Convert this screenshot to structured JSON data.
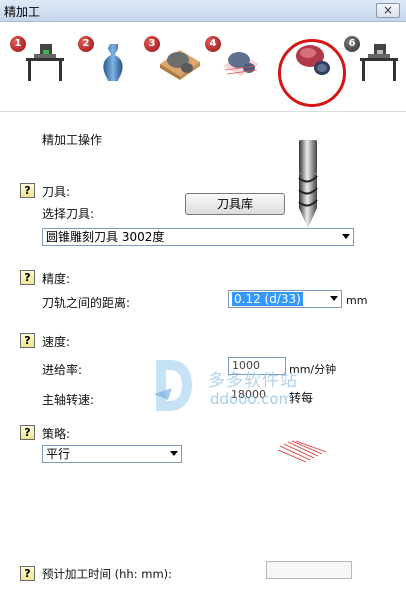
{
  "window": {
    "title": "精加工",
    "close_label": "×"
  },
  "steps": [
    {
      "number": "1",
      "icon": "machine-setup-icon"
    },
    {
      "number": "2",
      "icon": "model-vase-icon"
    },
    {
      "number": "3",
      "icon": "roughing-icon"
    },
    {
      "number": "4",
      "icon": "semi-finishing-icon"
    },
    {
      "number": "5",
      "icon": "finishing-icon",
      "active": true
    },
    {
      "number": "6",
      "icon": "machine-output-icon"
    }
  ],
  "panel": {
    "heading": "精加工操作",
    "tool": {
      "help": "?",
      "label": "刀具:",
      "select_label": "选择刀具:",
      "library_button": "刀具库",
      "selected": "圆锥雕刻刀具 3002度"
    },
    "precision": {
      "help": "?",
      "label": "精度:",
      "stepover_label": "刀轨之间的距离:",
      "stepover_value": "0.12  (d/33)",
      "unit": "mm"
    },
    "speed": {
      "help": "?",
      "label": "速度:",
      "feed_label": "进给率:",
      "feed_value": "1000",
      "feed_unit": "mm/分钟",
      "spindle_label": "主轴转速:",
      "spindle_value": "18000",
      "spindle_unit": "转每"
    },
    "strategy": {
      "help": "?",
      "label": "策略:",
      "selected": "平行"
    },
    "estimate": {
      "help": "?",
      "label": "预计加工时间 (hh: mm):",
      "value": ""
    }
  },
  "watermark": {
    "title": "多多软件站",
    "url": "ddooo.com"
  },
  "colors": {
    "accent": "#d51616",
    "selection": "#3399ff"
  }
}
